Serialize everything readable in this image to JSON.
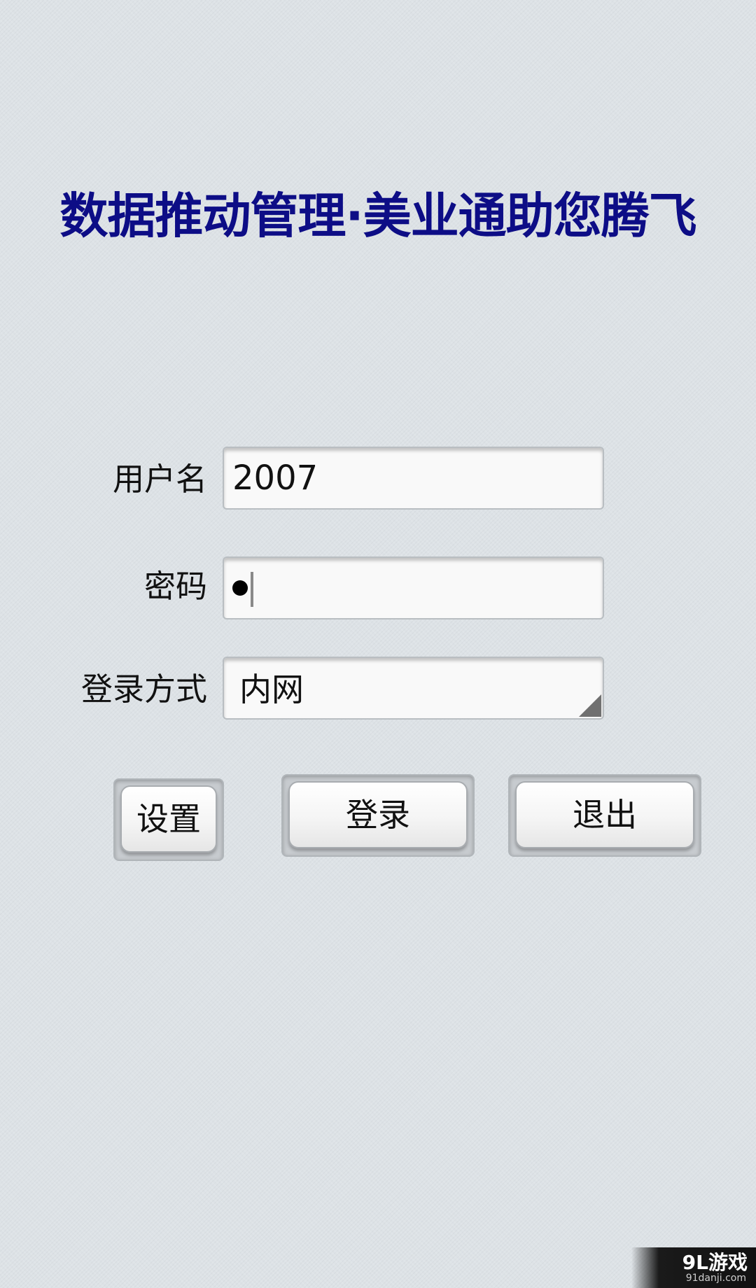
{
  "header": {
    "title": "数据推动管理·美业通助您腾飞"
  },
  "form": {
    "username_label": "用户名",
    "username_value": "2007",
    "password_label": "密码",
    "password_masked": "●",
    "login_mode_label": "登录方式",
    "login_mode_value": "内网"
  },
  "buttons": {
    "settings": "设置",
    "login": "登录",
    "exit": "退出"
  },
  "watermark": {
    "brand": "9L游戏",
    "site": "91danji.com"
  },
  "colors": {
    "title": "#0d0d86",
    "background": "#dde2e6"
  }
}
